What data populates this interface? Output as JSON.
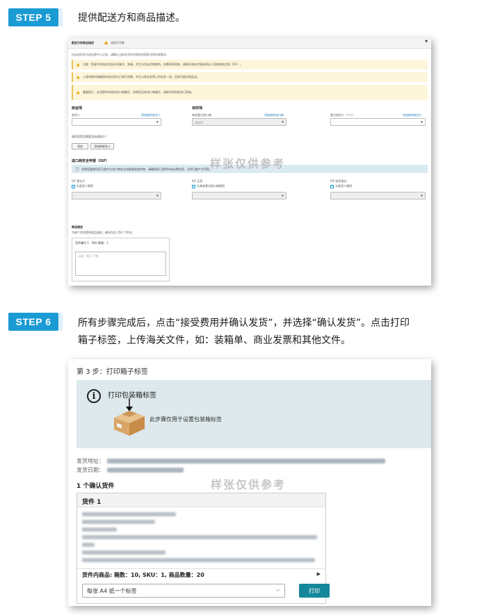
{
  "step5": {
    "badge": "STEP 5",
    "text": "提供配送方和商品描述。"
  },
  "step6": {
    "badge": "STEP 6",
    "text_line1": "所有步骤完成后，点击“接受费用并确认发货”，并选择“确认发货”。点击打印",
    "text_line2": "箱子标签，上传海关文件，如：装箱单、商业发票和其他文件。"
  },
  "watermark": "样张仅供参考",
  "frame1": {
    "header": {
      "title": "配送方和商品描述",
      "warn_text": "请填写完整"
    },
    "intro": "在运送到亚马逊运营中心之前，请确认当前发货符合相关的国家法律法规要求。",
    "alerts": [
      "注意：您填写的海关信息必须真实、准确，并且与实际货物相符。如需更多帮助，请联系海关代理或承运人获取相关信息（ISF）。",
      "入境申报时请确保所有信息均已填写完整，并且与商业发票上的信息一致，否则可能导致延误。",
      "重要提示：必须提供有效的进口商编号，如果您没有进口商编号，请联系您的报关行获取。"
    ],
    "origin_title": "启运地",
    "origin_label": "发货人",
    "origin_link": "添加新的发货人",
    "dest_title": "目的地",
    "dest_label": "海关登记进口商",
    "dest_link": "添加新的进口商",
    "dest_placeholder": "请选择",
    "ior_label": "登记收货人（个人）",
    "ior_link": "添加新的收货人",
    "question": "请问您是否需要添加通知方？",
    "btn_notify": "添加",
    "btn_add_new": "添加新联系人",
    "isf_title": "进口商安全申报（ISF）",
    "isf_info": "如果您要使用亚马逊作为进口商安全申报服务提供商，请确保您已提供所有必需信息，否则可能产生罚款。",
    "isf_col1": "ISF 提交方",
    "isf_col1_chk": "与发货人相同",
    "isf_col2": "ISF 买家",
    "isf_col2_chk": "与海关登记进口商相同",
    "isf_col3": "ISF 收货地址",
    "isf_col3_chk": "与发货人相同",
    "desc_title": "商品描述",
    "desc_hint": "为每个货件提供商品描述，最多包含 250 个字符。",
    "desc_box_head": "货件编号 1",
    "desc_box_sku": "SKU 数量：1",
    "desc_placeholder": "示例：男士 T 恤"
  },
  "frame2": {
    "title": "第 3 步：打印箱子标签",
    "banner_title": "打印包装箱标签",
    "banner_sub": "此步骤仅用于设置包装箱标签",
    "addr_label": "发货地址：",
    "date_label": "发货日期：",
    "confirm_count": "1 个确认货件",
    "shipment_title": "货件 1",
    "summary": "货件内商品: 箱数：10, SKU：1, 商品数量：20",
    "label_option": "每张 A4 纸一个标签",
    "print_button": "打印"
  }
}
